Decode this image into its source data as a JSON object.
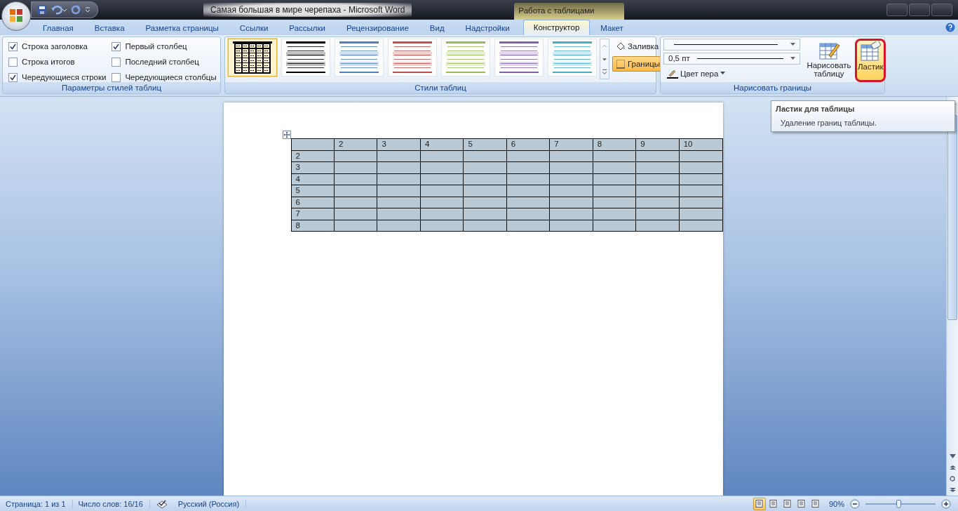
{
  "window": {
    "title": "Самая большая в мире черепаха - Microsoft Word",
    "context_header": "Работа с таблицами"
  },
  "tabs": [
    {
      "label": "Главная",
      "selected": false
    },
    {
      "label": "Вставка",
      "selected": false
    },
    {
      "label": "Разметка страницы",
      "selected": false
    },
    {
      "label": "Ссылки",
      "selected": false
    },
    {
      "label": "Рассылки",
      "selected": false
    },
    {
      "label": "Рецензирование",
      "selected": false
    },
    {
      "label": "Вид",
      "selected": false
    },
    {
      "label": "Надстройки",
      "selected": false
    },
    {
      "label": "Конструктор",
      "selected": true
    },
    {
      "label": "Макет",
      "selected": false
    }
  ],
  "style_options": {
    "group_label": "Параметры стилей таблиц",
    "options": [
      {
        "label": "Строка заголовка",
        "checked": true
      },
      {
        "label": "Строка итогов",
        "checked": false
      },
      {
        "label": "Чередующиеся строки",
        "checked": true
      },
      {
        "label": "Первый столбец",
        "checked": true
      },
      {
        "label": "Последний столбец",
        "checked": false
      },
      {
        "label": "Чередующиеся столбцы",
        "checked": false
      }
    ]
  },
  "table_styles": {
    "group_label": "Стили таблиц",
    "items": [
      {
        "kind": "grid",
        "color": "#000000",
        "selected": true
      },
      {
        "kind": "banded",
        "color": "#000000",
        "selected": false
      },
      {
        "kind": "banded",
        "color": "#4f81bd",
        "selected": false
      },
      {
        "kind": "banded",
        "color": "#c0504d",
        "selected": false
      },
      {
        "kind": "banded",
        "color": "#9bbb59",
        "selected": false
      },
      {
        "kind": "banded",
        "color": "#8064a2",
        "selected": false
      },
      {
        "kind": "banded",
        "color": "#4bacc6",
        "selected": false
      }
    ],
    "buttons": [
      {
        "label": "Заливка",
        "active": false
      },
      {
        "label": "Границы",
        "active": true
      }
    ]
  },
  "draw_borders": {
    "group_label": "Нарисовать границы",
    "line_weight": "0,5 пт",
    "pen_color": "Цвет пера",
    "buttons": [
      {
        "label": "Нарисовать таблицу",
        "selected": false
      },
      {
        "label": "Ластик",
        "selected": true
      }
    ]
  },
  "tooltip": {
    "title": "Ластик для таблицы",
    "text": "Удаление границ таблицы."
  },
  "document": {
    "table": {
      "columns": [
        "2",
        "3",
        "4",
        "5",
        "6",
        "7",
        "8",
        "9",
        "10"
      ],
      "row_labels": [
        "2",
        "3",
        "4",
        "5",
        "6",
        "7",
        "8"
      ]
    }
  },
  "status_bar": {
    "page": "Страница: 1 из 1",
    "words": "Число слов: 16/16",
    "language": "Русский (Россия)",
    "views": [
      {
        "selected": true
      },
      {
        "selected": false
      },
      {
        "selected": false
      },
      {
        "selected": false
      },
      {
        "selected": false
      }
    ],
    "zoom": "90%",
    "zoom_slider": {
      "level": 0.47
    }
  }
}
